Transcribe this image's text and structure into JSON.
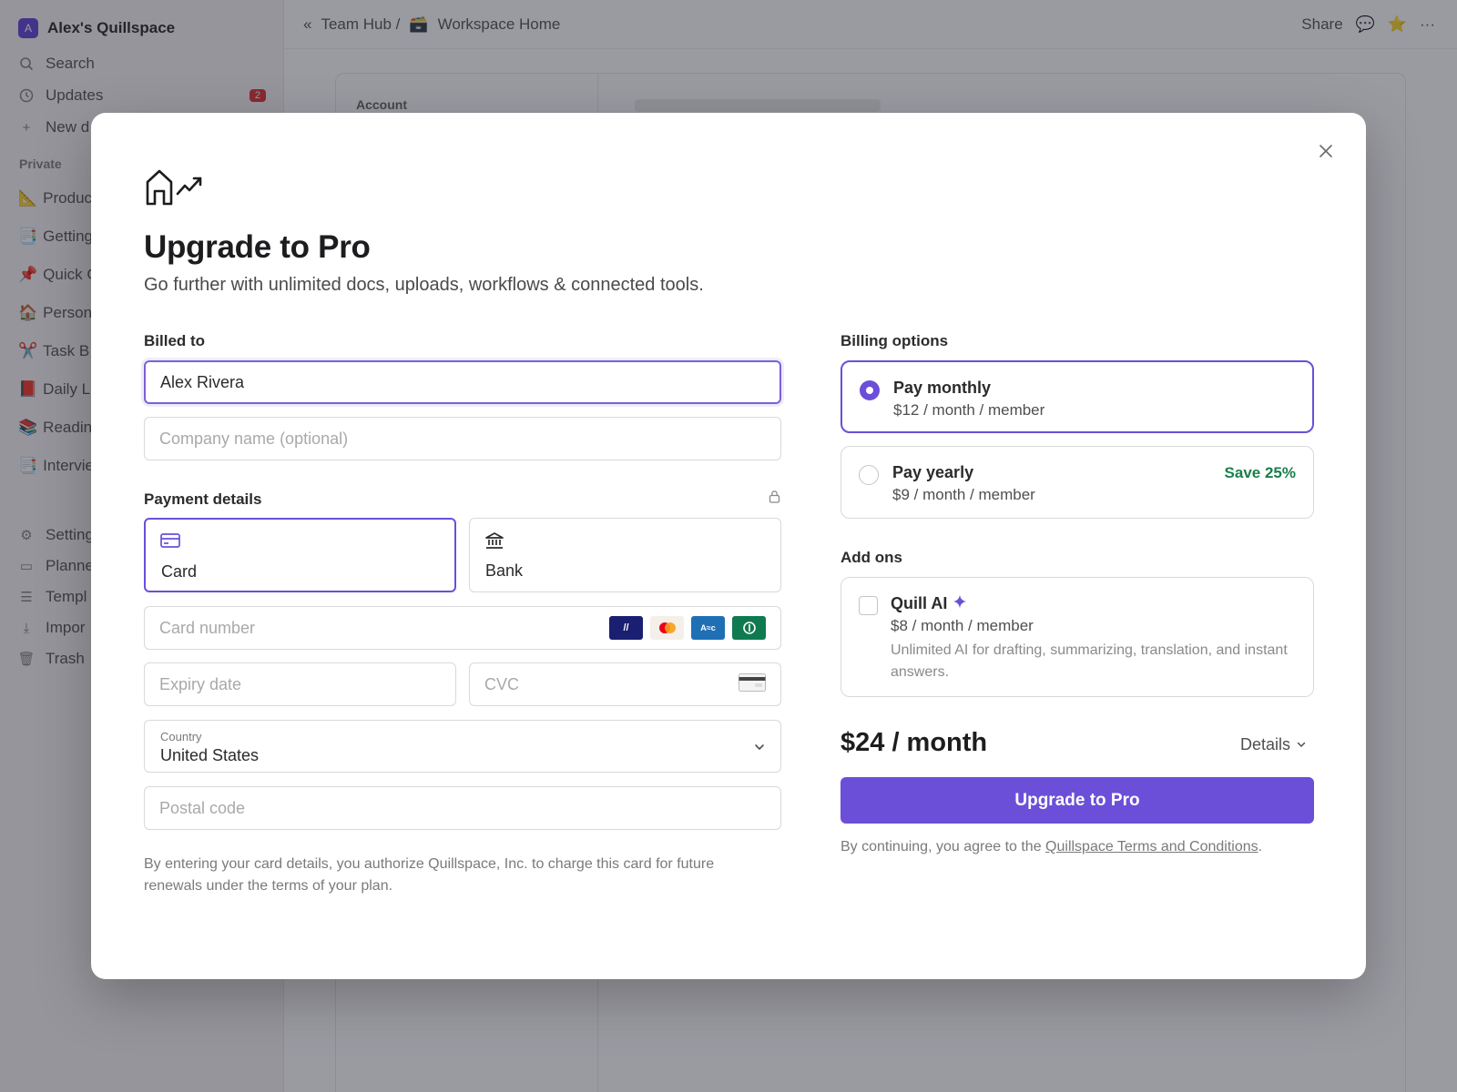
{
  "sidebar": {
    "workspace_initial": "A",
    "workspace_name": "Alex's Quillspace",
    "search": "Search",
    "updates": "Updates",
    "updates_count": "2",
    "new_doc": "New d",
    "section_private": "Private",
    "pages": [
      {
        "emoji": "📐",
        "label": "Produc"
      },
      {
        "emoji": "📑",
        "label": "Getting"
      },
      {
        "emoji": "📌",
        "label": "Quick C"
      },
      {
        "emoji": "🏠",
        "label": "Person"
      },
      {
        "emoji": "✂️",
        "label": "Task B"
      },
      {
        "emoji": "📕",
        "label": "Daily L"
      },
      {
        "emoji": "📚",
        "label": "Readin"
      },
      {
        "emoji": "📑",
        "label": "Intervie"
      }
    ],
    "bottom_items": [
      "Setting",
      "Planne",
      "Templ",
      "Impor",
      "Trash"
    ]
  },
  "topbar": {
    "breadcrumb_parent": "Team Hub /",
    "page_emoji": "🗃️",
    "page_title": "Workspace Home",
    "share": "Share",
    "collapse_glyph": "«"
  },
  "background": {
    "account_label": "Account"
  },
  "modal": {
    "title": "Upgrade to Pro",
    "subtitle": "Go further with unlimited docs, uploads, workflows & connected tools.",
    "billed_to_label": "Billed to",
    "name_value": "Alex Rivera",
    "company_placeholder": "Company name (optional)",
    "payment_label": "Payment details",
    "tab_card": "Card",
    "tab_bank": "Bank",
    "card_number_placeholder": "Card number",
    "expiry_placeholder": "Expiry date",
    "cvc_placeholder": "CVC",
    "country_label": "Country",
    "country_value": "United States",
    "postal_placeholder": "Postal code",
    "legal_left": "By entering your card details, you authorize Quillspace, Inc. to charge this card for future renewals under the terms of your plan.",
    "billing_options_label": "Billing options",
    "monthly_title": "Pay monthly",
    "monthly_price": "$12 / month / member",
    "yearly_title": "Pay yearly",
    "yearly_price": "$9 / month / member",
    "yearly_badge": "Save 25%",
    "addons_label": "Add ons",
    "addon_title": "Quill AI",
    "addon_price": "$8 / month / member",
    "addon_desc": "Unlimited AI for drafting, summarizing, translation, and instant answers.",
    "total": "$24 / month",
    "details": "Details",
    "upgrade_button": "Upgrade to Pro",
    "legal_right_prefix": "By continuing, you agree to the ",
    "legal_right_link": "Quillspace Terms and Conditions",
    "legal_right_suffix": "."
  },
  "colors": {
    "accent": "#6b4fd8",
    "save_green": "#1a7f4b",
    "badge_red": "#e03e3e"
  }
}
